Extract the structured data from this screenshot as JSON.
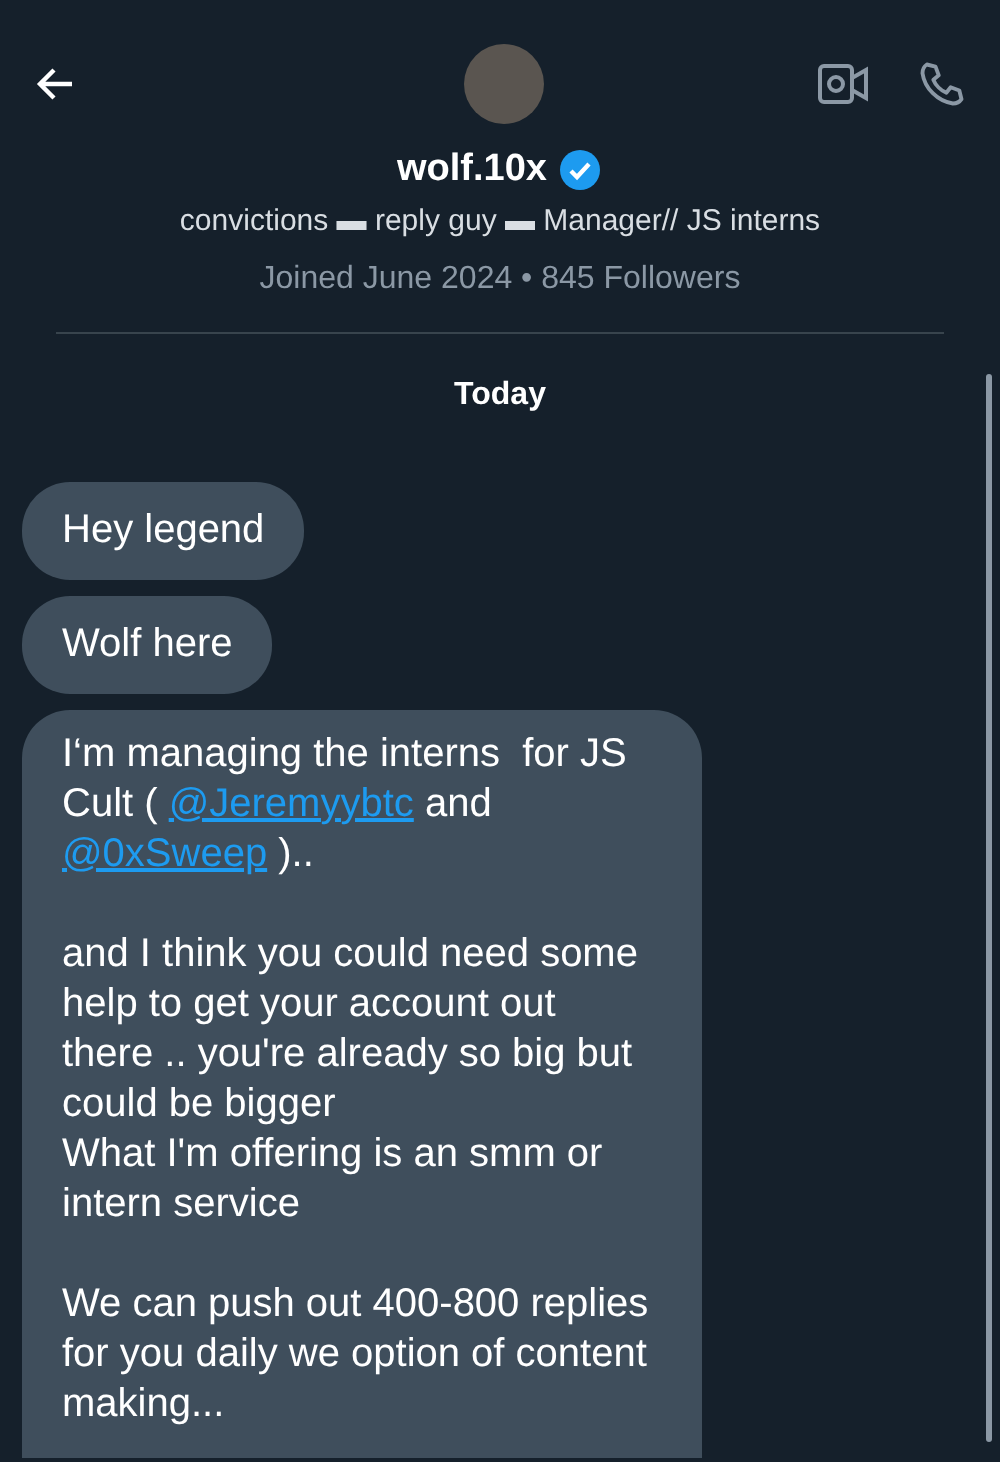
{
  "header": {
    "name": "wolf.10x",
    "verified": true
  },
  "profile": {
    "bio": "convictions ▬ reply guy ▬ Manager// JS interns",
    "meta": "Joined June 2024 • 845 Followers"
  },
  "date_divider": "Today",
  "messages": [
    {
      "kind": "short",
      "blocks": [
        [
          [
            {
              "kind": "text",
              "text": "Hey legend"
            }
          ]
        ]
      ]
    },
    {
      "kind": "short",
      "blocks": [
        [
          [
            {
              "kind": "text",
              "text": "Wolf here"
            }
          ]
        ]
      ]
    },
    {
      "kind": "long",
      "blocks": [
        [
          [
            {
              "kind": "text",
              "text": "I‘m managing the interns  for JS Cult ( "
            },
            {
              "kind": "mention",
              "text": "@Jeremyybtc"
            },
            {
              "kind": "text",
              "text": " and "
            },
            {
              "kind": "mention",
              "text": "@0xSweep"
            },
            {
              "kind": "text",
              "text": " ).."
            }
          ]
        ],
        [
          [
            {
              "kind": "text",
              "text": "and I think you could need some help to get your account out there .. you're already so big but could be bigger"
            }
          ],
          [
            {
              "kind": "text",
              "text": "What I'm offering is an smm or intern service"
            }
          ]
        ],
        [
          [
            {
              "kind": "text",
              "text": "We can push out 400-800 replies for you daily we option of content making..."
            }
          ]
        ]
      ]
    }
  ]
}
